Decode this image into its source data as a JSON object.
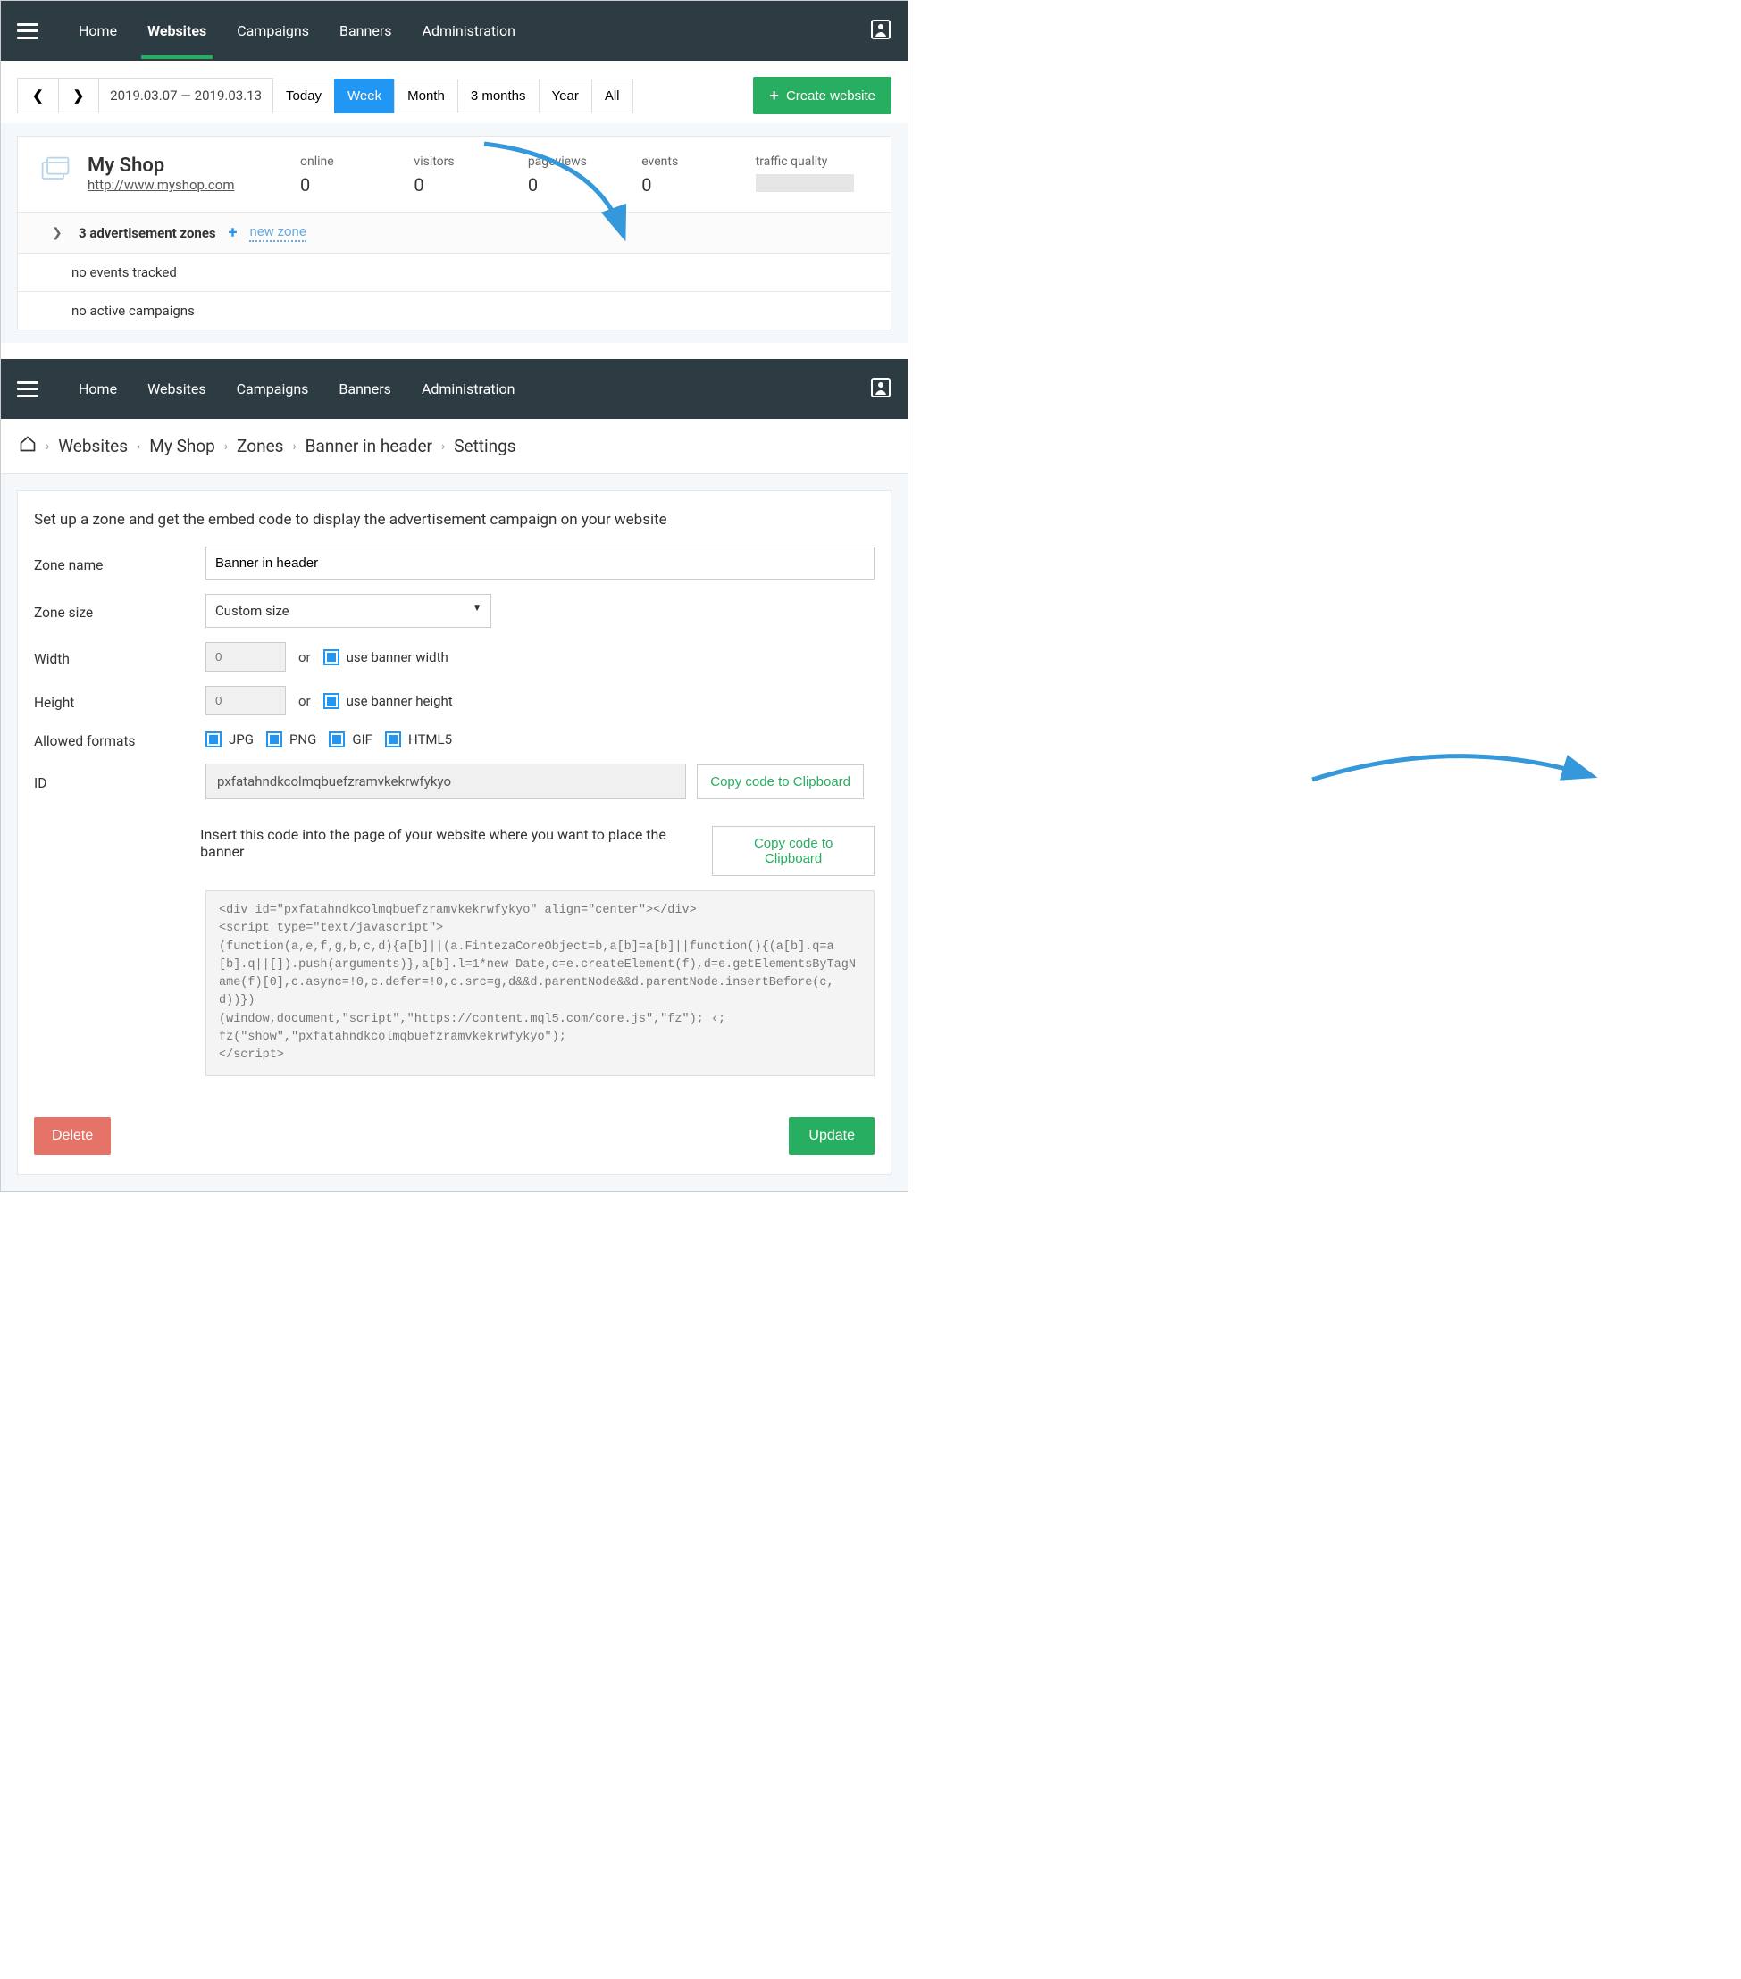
{
  "nav": {
    "items": [
      "Home",
      "Websites",
      "Campaigns",
      "Banners",
      "Administration"
    ],
    "active": "Websites"
  },
  "toolbar": {
    "date_range": "2019.03.07 — 2019.03.13",
    "ranges": [
      "Today",
      "Week",
      "Month",
      "3 months",
      "Year",
      "All"
    ],
    "active_range": "Week",
    "create_label": "Create website"
  },
  "site": {
    "title": "My Shop",
    "url": "http://www.myshop.com",
    "stats": [
      {
        "label": "online",
        "value": "0"
      },
      {
        "label": "visitors",
        "value": "0"
      },
      {
        "label": "pageviews",
        "value": "0"
      },
      {
        "label": "events",
        "value": "0"
      }
    ],
    "traffic_quality_label": "traffic quality",
    "zones_summary": "3 advertisement zones",
    "new_zone_label": "new zone",
    "no_events": "no events tracked",
    "no_campaigns": "no active campaigns"
  },
  "breadcrumb": [
    "Websites",
    "My Shop",
    "Zones",
    "Banner in header",
    "Settings"
  ],
  "settings": {
    "title": "Set up a zone and get the embed code to display the advertisement campaign on your website",
    "labels": {
      "zone_name": "Zone name",
      "zone_size": "Zone size",
      "width": "Width",
      "height": "Height",
      "allowed_formats": "Allowed formats",
      "id": "ID"
    },
    "zone_name_value": "Banner in header",
    "zone_size_value": "Custom size",
    "width_placeholder": "0",
    "height_placeholder": "0",
    "or": "or",
    "use_banner_width": "use banner width",
    "use_banner_height": "use banner height",
    "formats": [
      "JPG",
      "PNG",
      "GIF",
      "HTML5"
    ],
    "id_value": "pxfatahndkcolmqbuefzramvkekrwfykyo",
    "copy_label": "Copy code to Clipboard",
    "insert_text": "Insert this code into the page of your website where you want to place the banner",
    "code": "<div id=\"pxfatahndkcolmqbuefzramvkekrwfykyo\" align=\"center\"></div>\n<script type=\"text/javascript\">\n(function(a,e,f,g,b,c,d){a[b]||(a.FintezaCoreObject=b,a[b]=a[b]||function(){(a[b].q=a[b].q||[]).push(arguments)},a[b].l=1*new Date,c=e.createElement(f),d=e.getElementsByTagName(f)[0],c.async=!0,c.defer=!0,c.src=g,d&&d.parentNode&&d.parentNode.insertBefore(c,d))})\n(window,document,\"script\",\"https://content.mql5.com/core.js\",\"fz\"); ‹;\nfz(\"show\",\"pxfatahndkcolmqbuefzramvkekrwfykyo\");\n</scr​ipt>",
    "delete_label": "Delete",
    "update_label": "Update"
  }
}
